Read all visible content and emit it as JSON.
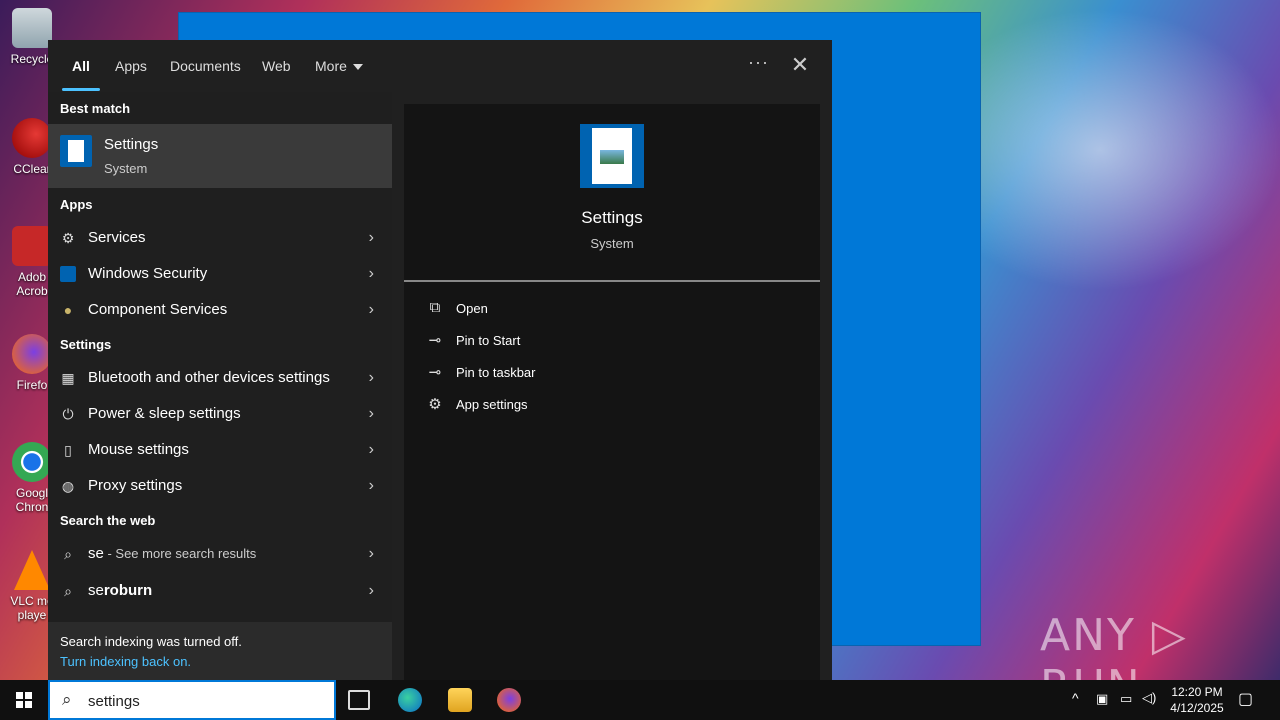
{
  "desktop": {
    "icons": [
      {
        "label": "Recycle"
      },
      {
        "label": "CClear"
      },
      {
        "label": "Adob Acrob"
      },
      {
        "label": "Firefo"
      },
      {
        "label": "Googl Chron"
      },
      {
        "label": "VLC me playe"
      }
    ]
  },
  "watermark": "ANY ▷ RUN",
  "search": {
    "tabs": [
      {
        "label": "All"
      },
      {
        "label": "Apps"
      },
      {
        "label": "Documents"
      },
      {
        "label": "Web"
      },
      {
        "label": "More"
      }
    ],
    "more_options": "···",
    "close": "✕",
    "best_match_header": "Best match",
    "best_match": {
      "name": "Settings",
      "type": "System"
    },
    "apps_header": "Apps",
    "apps": [
      {
        "label": "Services"
      },
      {
        "label": "Windows Security"
      },
      {
        "label": "Component Services"
      }
    ],
    "settings_header": "Settings",
    "settings": [
      {
        "label": "Bluetooth and other devices settings"
      },
      {
        "label": "Power & sleep settings"
      },
      {
        "label": "Mouse settings"
      },
      {
        "label": "Proxy settings"
      }
    ],
    "web_header": "Search the web",
    "web": [
      {
        "query": "se",
        "suffix": " - See more search results"
      },
      {
        "query": "seroburn",
        "suffix": ""
      }
    ],
    "notice": {
      "text": "Search indexing was turned off.",
      "link": "Turn indexing back on."
    },
    "detail": {
      "title": "Settings",
      "subtitle": "System",
      "actions": [
        {
          "label": "Open"
        },
        {
          "label": "Pin to Start"
        },
        {
          "label": "Pin to taskbar"
        },
        {
          "label": "App settings"
        }
      ]
    }
  },
  "taskbar": {
    "search_value": "settings",
    "time": "12:20 PM",
    "date": "4/12/2025"
  },
  "colors": {
    "accent": "#4cc2ff",
    "window_blue": "#0078d7",
    "panel_bg": "#202020",
    "selected_bg": "#3a3a3a"
  }
}
